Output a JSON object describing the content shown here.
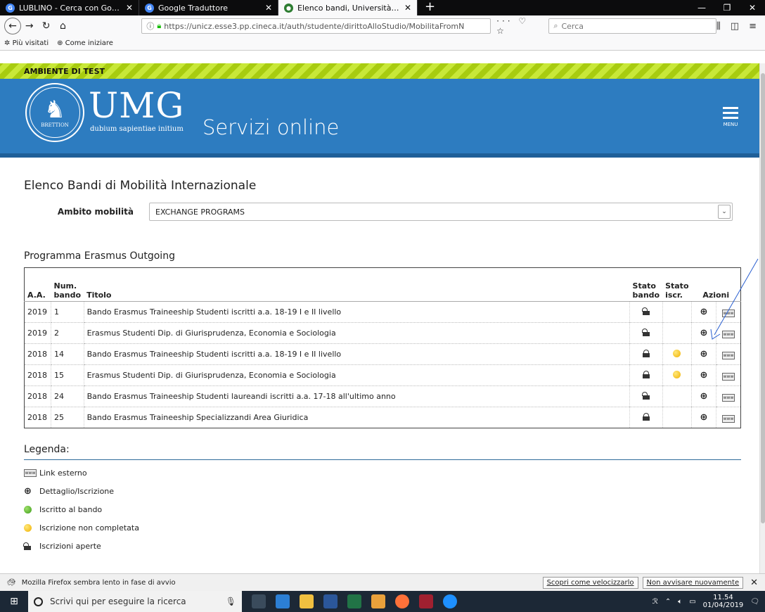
{
  "browser": {
    "tabs": [
      {
        "title": "LUBLINO - Cerca con Google",
        "color": "#4285f4",
        "glyph": "G"
      },
      {
        "title": "Google Traduttore",
        "color": "#4285f4",
        "glyph": "G"
      },
      {
        "title": "Elenco bandi, Università di UNI",
        "color": "#2e7d32",
        "glyph": "●"
      }
    ],
    "new_tab": "+",
    "url": "https://unicz.esse3.pp.cineca.it/auth/studente/dirittoAlloStudio/MobilitaFromN",
    "search_placeholder": "Cerca",
    "bookmarks": [
      "Più visitati",
      "Come iniziare"
    ]
  },
  "page": {
    "test_env": "AMBIENTE DI TEST",
    "logo": {
      "name": "UMG",
      "motto": "dubium sapientiae initium",
      "seal_text": "BRETTION"
    },
    "service_title": "Servizi online",
    "menu_label": "MENU",
    "heading": "Elenco Bandi di Mobilità Internazionale",
    "ambito": {
      "label": "Ambito mobilità",
      "value": "EXCHANGE PROGRAMS"
    },
    "programma": "Programma Erasmus Outgoing",
    "table": {
      "headers": {
        "aa": "A.A.",
        "num_1": "Num.",
        "num_2": "bando",
        "titolo": "Titolo",
        "sb_1": "Stato",
        "sb_2": "bando",
        "si_1": "Stato",
        "si_2": "iscr.",
        "azioni": "Azioni"
      },
      "rows": [
        {
          "aa": "2019",
          "num": "1",
          "titolo": "Bando Erasmus Traineeship Studenti iscritti a.a. 18-19 I e II livello",
          "stato_bando": "open",
          "stato_iscr": ""
        },
        {
          "aa": "2019",
          "num": "2",
          "titolo": "Erasmus Studenti Dip. di Giurisprudenza, Economia e Sociologia",
          "stato_bando": "open",
          "stato_iscr": ""
        },
        {
          "aa": "2018",
          "num": "14",
          "titolo": "Bando Erasmus Traineeship Studenti iscritti a.a. 18-19 I e II livello",
          "stato_bando": "closed",
          "stato_iscr": "yellow"
        },
        {
          "aa": "2018",
          "num": "15",
          "titolo": "Erasmus Studenti Dip. di Giurisprudenza, Economia e Sociologia",
          "stato_bando": "closed",
          "stato_iscr": "yellow"
        },
        {
          "aa": "2018",
          "num": "24",
          "titolo": "Bando Erasmus Traineeship Studenti laureandi iscritti a.a. 17-18 all'ultimo anno",
          "stato_bando": "open",
          "stato_iscr": ""
        },
        {
          "aa": "2018",
          "num": "25",
          "titolo": "Bando Erasmus Traineeship Specializzandi Area Giuridica",
          "stato_bando": "closed",
          "stato_iscr": ""
        }
      ]
    },
    "legenda": {
      "title": "Legenda:",
      "items": [
        {
          "icon": "www-icon",
          "label": "Link esterno"
        },
        {
          "icon": "zoom-icon",
          "label": "Dettaglio/Iscrizione"
        },
        {
          "icon": "green-dot",
          "label": "Iscritto al bando"
        },
        {
          "icon": "yellow-dot",
          "label": "Iscrizione non completata"
        },
        {
          "icon": "lock-open",
          "label": "Iscrizioni aperte"
        }
      ]
    }
  },
  "notification": {
    "message": "Mozilla Firefox sembra lento in fase di avvio",
    "btn_speed": "Scopri come velocizzarlo",
    "btn_dismiss": "Non avvisare nuovamente"
  },
  "taskbar": {
    "search": "Scrivi qui per eseguire la ricerca",
    "time": "11.54",
    "date": "01/04/2019"
  },
  "colors": {
    "banner": "#2d7cc0",
    "test_bar": "#b6dc20"
  }
}
